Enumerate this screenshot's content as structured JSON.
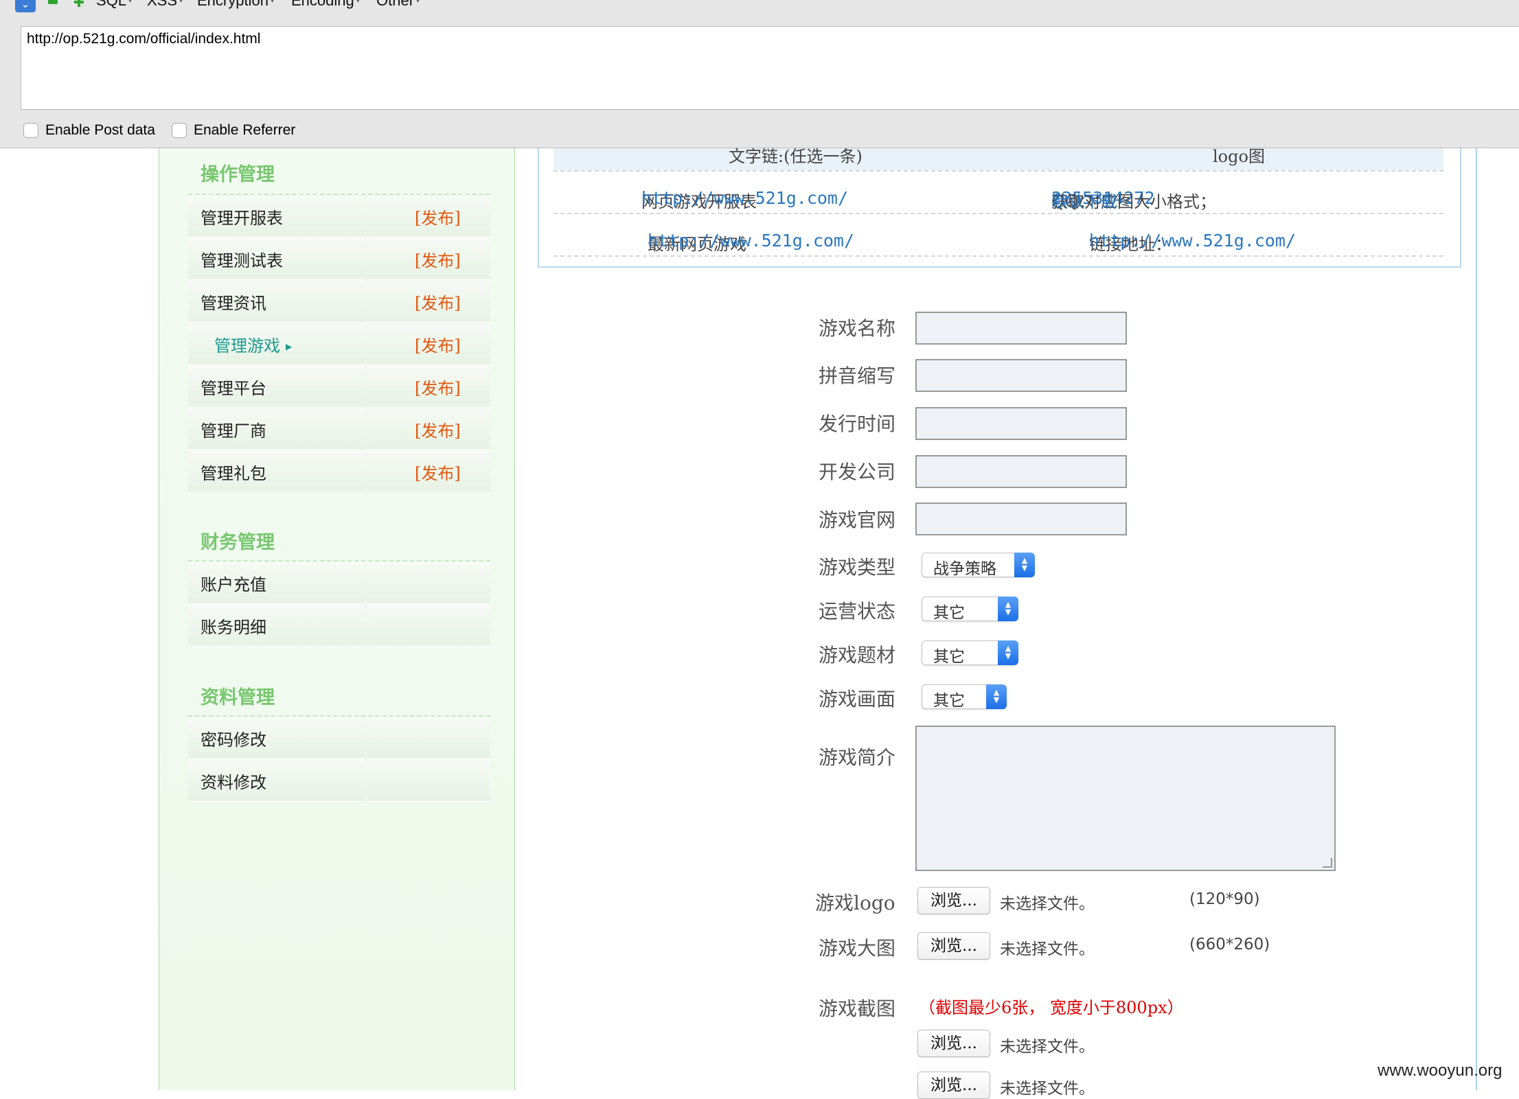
{
  "hackbar": {
    "menu": [
      "SQL",
      "XSS",
      "Encryption",
      "Encoding",
      "Other"
    ],
    "url": "http://op.521g.com/official/index.html",
    "enable_post": "Enable Post data",
    "enable_referrer": "Enable Referrer"
  },
  "sidebar": {
    "section1": "操作管理",
    "section1_items": [
      {
        "label": "管理开服表",
        "action": "[发布]"
      },
      {
        "label": "管理测试表",
        "action": "[发布]"
      },
      {
        "label": "管理资讯",
        "action": "[发布]"
      },
      {
        "label": "管理游戏",
        "action": "[发布]"
      },
      {
        "label": "管理平台",
        "action": "[发布]"
      },
      {
        "label": "管理厂商",
        "action": "[发布]"
      },
      {
        "label": "管理礼包",
        "action": "[发布]"
      }
    ],
    "section2": "财务管理",
    "section2_items": [
      "账户充值",
      "账务明细"
    ],
    "section3": "资料管理",
    "section3_items": [
      "密码修改",
      "资料修改"
    ]
  },
  "info": {
    "head_left": "文字链:(任选一条)",
    "head_right": "logo图",
    "row1_text": "网页游戏开服表",
    "row1_link": "http://www.521g.com/",
    "row1_qq_label": "QQ：",
    "row1_qq": "2355314272",
    "row1_qq_tail": "获取对应图大小格式；",
    "row1_download": "默认下载",
    "row2_text": "最新网页游戏",
    "row2_link": "http://www.521g.com/",
    "row2_addr_label": "链接地址：",
    "row2_addr": "http://www.521g.com/"
  },
  "form": {
    "name": "游戏名称",
    "pinyin": "拼音缩写",
    "release": "发行时间",
    "developer": "开发公司",
    "website": "游戏官网",
    "type_label": "游戏类型",
    "type_value": "战争策略",
    "status_label": "运营状态",
    "status_value": "其它",
    "theme_label": "游戏题材",
    "theme_value": "其它",
    "graphics_label": "游戏画面",
    "graphics_value": "其它",
    "intro": "游戏简介",
    "logo_label": "游戏logo",
    "bigpic_label": "游戏大图",
    "screens_label": "游戏截图",
    "browse": "浏览...",
    "no_file": "未选择文件。",
    "logo_size": "(120*90)",
    "big_size": "(660*260)",
    "screens_note": "（截图最少6张， 宽度小于800px）"
  },
  "watermark": "www.wooyun.org"
}
